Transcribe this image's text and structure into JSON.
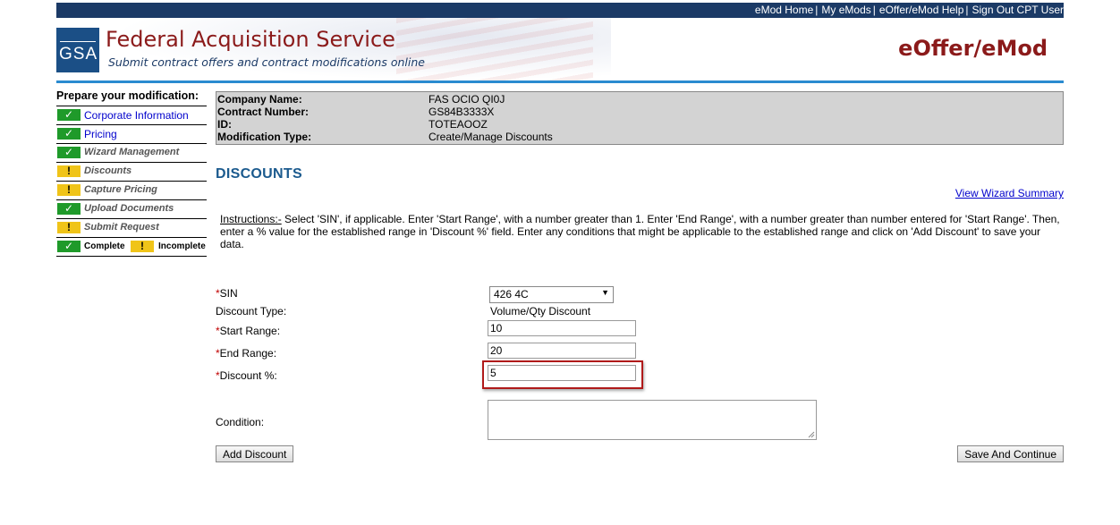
{
  "topnav": {
    "links": [
      "eMod Home",
      "My eMods",
      "eOffer/eMod Help",
      "Sign Out CPT User"
    ],
    "separator": "|"
  },
  "header": {
    "logo_text": "GSA",
    "title": "Federal Acquisition Service",
    "subtitle": "Submit contract offers and contract modifications online",
    "app_name": "eOffer/eMod",
    "colors": {
      "title": "#8b1a1a",
      "bar": "#1b3a66",
      "rule": "#2a8bd0"
    }
  },
  "sidebar": {
    "heading": "Prepare your modification:",
    "items": [
      {
        "label": "Corporate Information",
        "status": "complete",
        "link": true
      },
      {
        "label": "Pricing",
        "status": "complete",
        "link": true
      },
      {
        "label": "Wizard Management",
        "status": "complete",
        "link": false
      },
      {
        "label": "Discounts",
        "status": "incomplete",
        "link": false
      },
      {
        "label": "Capture Pricing",
        "status": "incomplete",
        "link": false
      },
      {
        "label": "Upload Documents",
        "status": "complete",
        "link": false
      },
      {
        "label": "Submit Request",
        "status": "incomplete",
        "link": false
      }
    ],
    "legend": {
      "complete": "Complete",
      "incomplete": "Incomplete"
    },
    "status_icons": {
      "complete": "✓",
      "incomplete": "!"
    }
  },
  "info": {
    "company_label": "Company Name:",
    "company_value": "FAS OCIO QI0J",
    "contract_label": "Contract Number:",
    "contract_value": "GS84B3333X",
    "id_label": "ID:",
    "id_value": "TOTEAOOZ",
    "modtype_label": "Modification Type:",
    "modtype_value": "Create/Manage Discounts"
  },
  "main": {
    "title": "DISCOUNTS",
    "wizard_link": "View Wizard Summary",
    "instructions_label": "Instructions:-",
    "instructions_text": " Select 'SIN', if applicable. Enter 'Start Range', with a number greater than 1. Enter 'End Range', with a number greater than number entered for 'Start Range'. Then, enter a % value for the established range in 'Discount %' field. Enter any conditions that might be applicable to the established range and click on 'Add Discount' to save your data."
  },
  "form": {
    "required_marker": "*",
    "sin_label": "SIN",
    "sin_value": "426 4C",
    "discount_type_label": "Discount Type:",
    "discount_type_value": "Volume/Qty Discount",
    "start_label": "Start Range:",
    "start_value": "10",
    "end_label": "End Range:",
    "end_value": "20",
    "discount_label": "Discount %:",
    "discount_value": "5",
    "condition_label": "Condition:",
    "condition_value": "",
    "add_button": "Add Discount",
    "save_button": "Save And Continue"
  }
}
